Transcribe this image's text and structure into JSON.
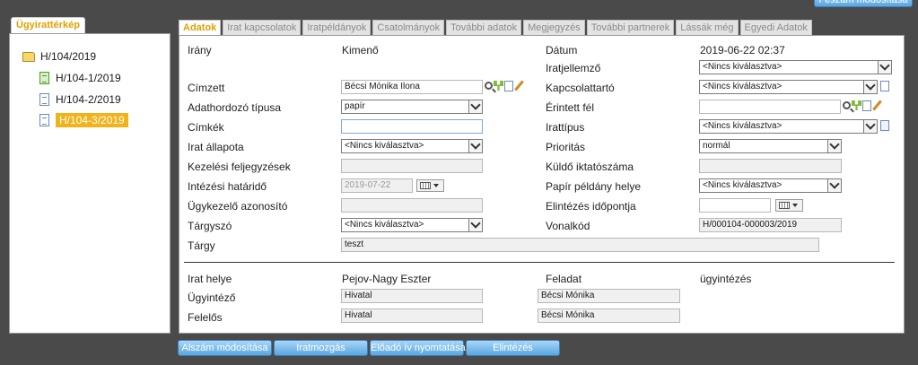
{
  "top_button": "Feszám módosítása",
  "tree": {
    "tab_label": "Ügyirattérkép",
    "root": "H/104/2019",
    "children": [
      "H/104-1/2019",
      "H/104-2/2019",
      "H/104-3/2019"
    ]
  },
  "tabs": [
    "Adatok",
    "Irat kapcsolatok",
    "Iratpéldányok",
    "Csatolmányok",
    "További adatok",
    "Megjegyzés",
    "További partnerek",
    "Lássák még",
    "Egyedi Adatok"
  ],
  "left": {
    "irany_label": "Irány",
    "irany_value": "Kimenő",
    "cimzett_label": "Címzett",
    "cimzett_value": "Bécsi Mónika Ilona",
    "adathordozo_label": "Adathordozó típusa",
    "adathordozo_value": "papír",
    "cimkek_label": "Címkék",
    "cimkek_value": "",
    "allapot_label": "Irat állapota",
    "allapot_value": "<Nincs kiválasztva>",
    "kezelesi_label": "Kezelési feljegyzések",
    "kezelesi_value": "",
    "hatarido_label": "Intézési határidő",
    "hatarido_value": "2019-07-22",
    "ugykezelo_label": "Ügykezelő azonosító",
    "ugykezelo_value": "",
    "targyszo_label": "Tárgyszó",
    "targyszo_value": "<Nincs kiválasztva>",
    "targy_label": "Tárgy",
    "targy_value": "teszt"
  },
  "right": {
    "datum_label": "Dátum",
    "datum_value": "2019-06-22 02:37",
    "iratjellemzo_label": "Iratjellemző",
    "iratjellemzo_value": "<Nincs kiválasztva>",
    "kapcsolattarto_label": "Kapcsolattartó",
    "kapcsolattarto_value": "<Nincs kiválasztva>",
    "erintett_label": "Érintett fél",
    "erintett_value": "",
    "irattipus_label": "Irattípus",
    "irattipus_value": "<Nincs kiválasztva>",
    "prioritas_label": "Prioritás",
    "prioritas_value": "normál",
    "kuldo_label": "Küldő iktatószáma",
    "kuldo_value": "",
    "papir_label": "Papír példány helye",
    "papir_value": "<Nincs kiválasztva>",
    "elintezes_label": "Elintézés időpontja",
    "elintezes_value": "",
    "vonalkod_label": "Vonalkód",
    "vonalkod_value": "H/000104-000003/2019"
  },
  "lower": {
    "irathelye_label": "Irat helye",
    "irathelye_value": "Pejov-Nagy Eszter",
    "feladat_label": "Feladat",
    "feladat_value": "ügyintézés",
    "ugyintezo_label": "Ügyintéző",
    "ugyintezo_value": "Hivatal",
    "ugyintezo_person": "Bécsi Mónika",
    "felelos_label": "Felelős",
    "felelos_value": "Hivatal",
    "felelos_person": "Bécsi Mónika"
  },
  "buttons": [
    "Alszám módosítása",
    "Iratmozgás",
    "Előadó ív nyomtatása",
    "Elintézés"
  ]
}
